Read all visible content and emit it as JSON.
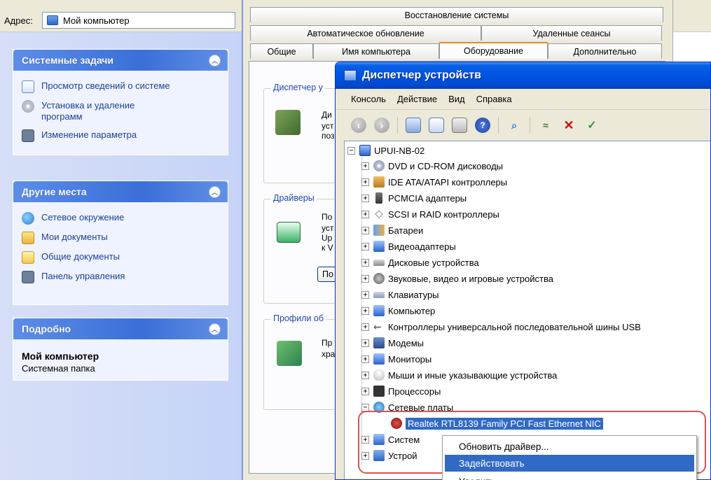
{
  "address_bar": {
    "label": "Адрес:",
    "value": "Мой компьютер"
  },
  "left_pane": {
    "system_tasks": {
      "title": "Системные задачи",
      "items": [
        {
          "label": "Просмотр сведений о системе",
          "icon": "system-info-icon"
        },
        {
          "label": "Установка и удаление программ",
          "icon": "add-remove-icon"
        },
        {
          "label": "Изменение параметра",
          "icon": "settings-arrow-icon"
        }
      ]
    },
    "other_places": {
      "title": "Другие места",
      "items": [
        {
          "label": "Сетевое окружение",
          "icon": "network-icon"
        },
        {
          "label": "Мои документы",
          "icon": "documents-folder-icon"
        },
        {
          "label": "Общие документы",
          "icon": "shared-folder-icon"
        },
        {
          "label": "Панель управления",
          "icon": "control-panel-icon"
        }
      ]
    },
    "details": {
      "title": "Подробно",
      "name": "Мой компьютер",
      "subtitle": "Системная папка"
    }
  },
  "system_properties": {
    "tabs_row1": [
      "Восстановление системы"
    ],
    "tabs_row2": [
      "Автоматическое обновление",
      "Удаленные сеансы"
    ],
    "tabs_row3": [
      "Общие",
      "Имя компьютера",
      "Оборудование",
      "Дополнительно"
    ],
    "active_tab": "Оборудование",
    "groups": {
      "device_manager": {
        "label": "Диспетчер у",
        "text": [
          "Ди",
          "уст",
          "поз"
        ]
      },
      "drivers": {
        "label": "Драйверы",
        "text": [
          "По",
          "уст",
          "Up",
          "к V"
        ],
        "button": "По"
      },
      "profiles": {
        "label": "Профили об",
        "text": [
          "Пр",
          "хра"
        ]
      }
    }
  },
  "device_manager": {
    "title": "Диспетчер устройств",
    "menu": [
      "Консоль",
      "Действие",
      "Вид",
      "Справка"
    ],
    "tree": {
      "root": "UPUI-NB-02",
      "categories": [
        {
          "label": "DVD и CD-ROM дисководы",
          "icon": "dvd-drive-icon",
          "expanded": false
        },
        {
          "label": "IDE ATA/ATAPI контроллеры",
          "icon": "ide-controller-icon",
          "expanded": false
        },
        {
          "label": "PCMCIA адаптеры",
          "icon": "pcmcia-icon",
          "expanded": false
        },
        {
          "label": "SCSI и RAID контроллеры",
          "icon": "scsi-icon",
          "expanded": false
        },
        {
          "label": "Батареи",
          "icon": "battery-icon",
          "expanded": false
        },
        {
          "label": "Видеоадаптеры",
          "icon": "display-adapter-icon",
          "expanded": false
        },
        {
          "label": "Дисковые устройства",
          "icon": "disk-drive-icon",
          "expanded": false
        },
        {
          "label": "Звуковые, видео и игровые устройства",
          "icon": "sound-icon",
          "expanded": false
        },
        {
          "label": "Клавиатуры",
          "icon": "keyboard-icon",
          "expanded": false
        },
        {
          "label": "Компьютер",
          "icon": "computer-icon",
          "expanded": false
        },
        {
          "label": "Контроллеры универсальной последовательной шины USB",
          "icon": "usb-icon",
          "expanded": false
        },
        {
          "label": "Модемы",
          "icon": "modem-icon",
          "expanded": false
        },
        {
          "label": "Мониторы",
          "icon": "monitor-icon",
          "expanded": false
        },
        {
          "label": "Мыши и иные указывающие устройства",
          "icon": "mouse-icon",
          "expanded": false
        },
        {
          "label": "Процессоры",
          "icon": "processor-icon",
          "expanded": false
        },
        {
          "label": "Сетевые платы",
          "icon": "network-adapter-icon",
          "expanded": true
        },
        {
          "label": "Realtek RTL8139 Family PCI Fast Ethernet NIC",
          "icon": "nic-disabled-icon",
          "child": true,
          "selected": true
        },
        {
          "label": "Систем",
          "icon": "system-devices-icon",
          "expanded": false
        },
        {
          "label": "Устрой",
          "icon": "devices-icon",
          "expanded": false
        }
      ]
    }
  },
  "context_menu": {
    "items": [
      {
        "label": "Обновить драйвер...",
        "highlighted": false
      },
      {
        "label": "Задействовать",
        "highlighted": true
      },
      {
        "label": "Удалить",
        "highlighted": false
      }
    ]
  },
  "colors": {
    "xp_title_blue": "#0054e3",
    "selection_blue": "#316ac5",
    "highlight_red": "#d9534f",
    "task_pane_bg": "#d6dff7"
  }
}
